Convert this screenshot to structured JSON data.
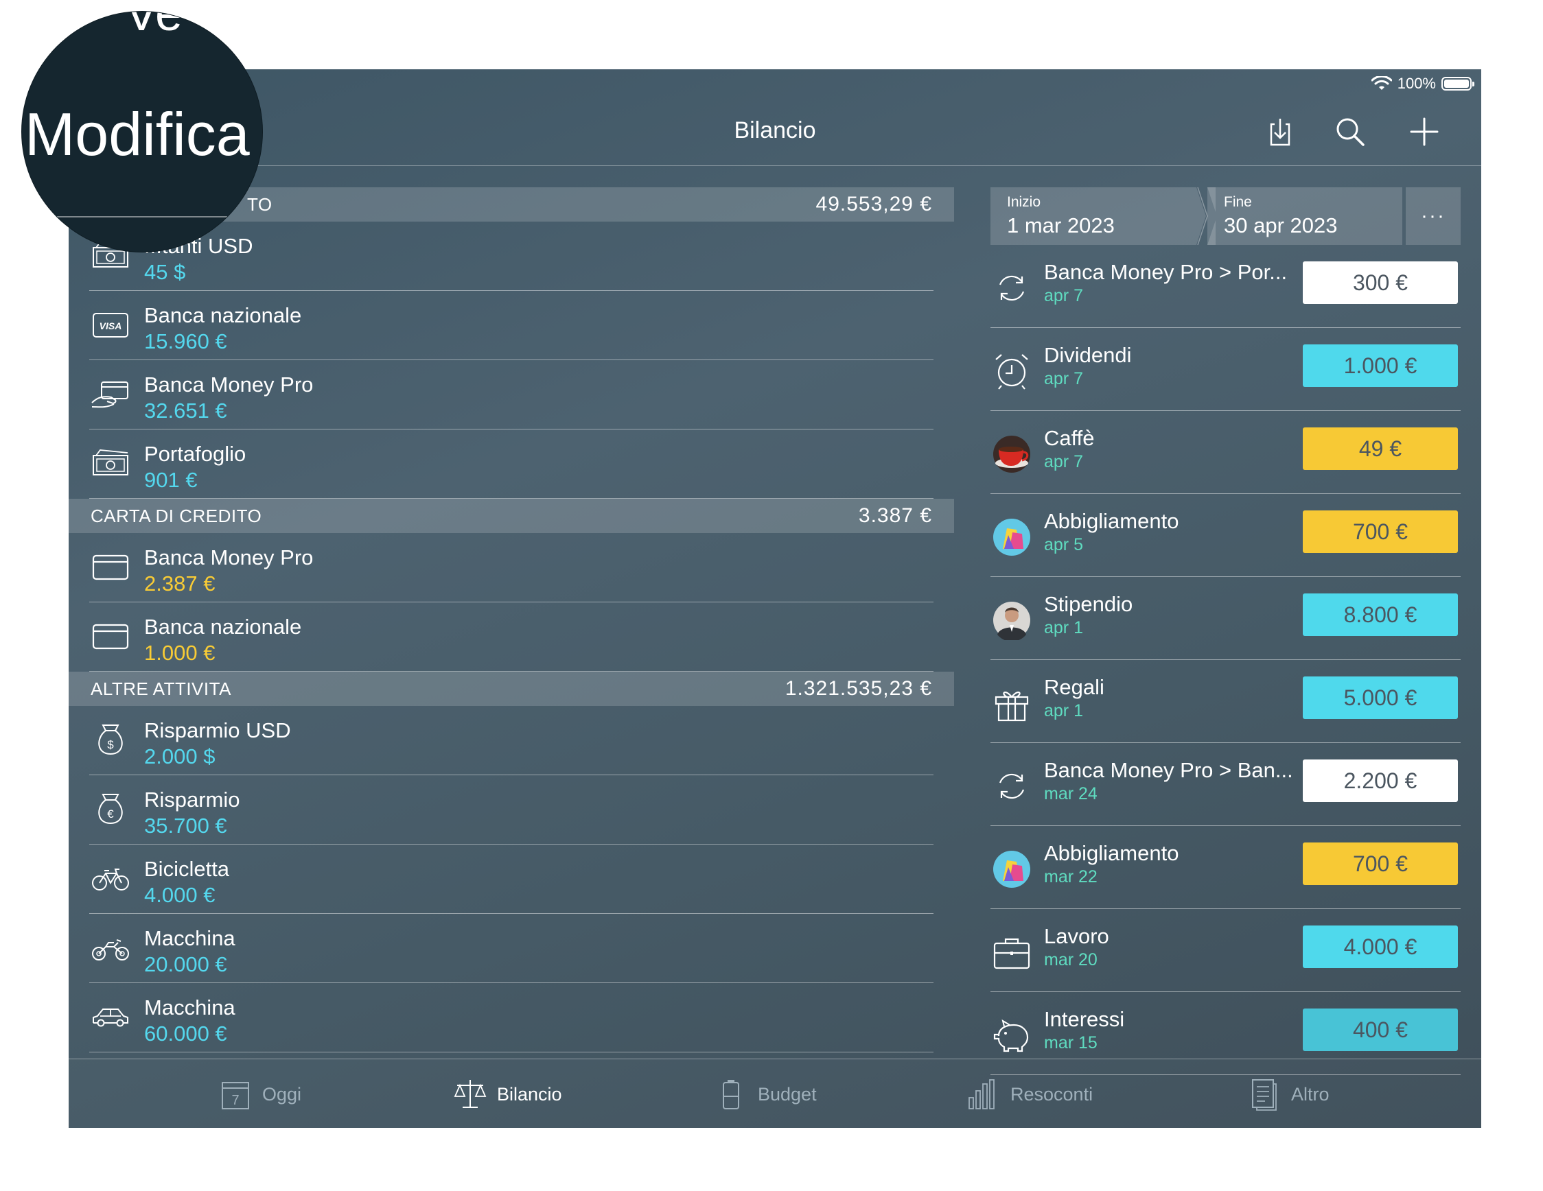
{
  "status": {
    "battery": "100%"
  },
  "navbar": {
    "title": "Bilancio",
    "edit_label": "Modifica",
    "edit_top_fragment": "Ve"
  },
  "sections": [
    {
      "title": "CONTANTI",
      "title_visible": "TO",
      "total": "49.553,29 €",
      "accounts": [
        {
          "name": "Contanti USD",
          "name_visible": "...tanti USD",
          "amount": "45 $",
          "color": "cyan",
          "icon": "cash-icon"
        },
        {
          "name": "Banca nazionale",
          "amount": "15.960 €",
          "color": "cyan",
          "icon": "visa-card-icon"
        },
        {
          "name": "Banca Money Pro",
          "amount": "32.651 €",
          "color": "cyan",
          "icon": "card-in-hand-icon"
        },
        {
          "name": "Portafoglio",
          "amount": "901 €",
          "color": "cyan",
          "icon": "cash-icon"
        }
      ]
    },
    {
      "title": "CARTA DI CREDITO",
      "total": "3.387 €",
      "accounts": [
        {
          "name": "Banca Money Pro",
          "amount": "2.387 €",
          "color": "yellow",
          "icon": "credit-card-icon"
        },
        {
          "name": "Banca nazionale",
          "amount": "1.000 €",
          "color": "yellow",
          "icon": "credit-card-icon"
        }
      ]
    },
    {
      "title": "ALTRE ATTIVITA",
      "total": "1.321.535,23 €",
      "accounts": [
        {
          "name": "Risparmio USD",
          "amount": "2.000 $",
          "color": "cyan",
          "icon": "money-bag-dollar-icon"
        },
        {
          "name": "Risparmio",
          "amount": "35.700 €",
          "color": "cyan",
          "icon": "money-bag-euro-icon"
        },
        {
          "name": "Bicicletta",
          "amount": "4.000 €",
          "color": "cyan",
          "icon": "bicycle-icon"
        },
        {
          "name": "Macchina",
          "amount": "20.000 €",
          "color": "cyan",
          "icon": "motorcycle-icon"
        },
        {
          "name": "Macchina",
          "amount": "60.000 €",
          "color": "cyan",
          "icon": "car-icon"
        }
      ]
    }
  ],
  "date_range": {
    "start_label": "Inizio",
    "start_value": "1 mar 2023",
    "end_label": "Fine",
    "end_value": "30 apr 2023",
    "more": "···"
  },
  "transactions": [
    {
      "name": "Banca Money Pro > Por...",
      "date": "apr 7",
      "amount": "300 €",
      "style": "white",
      "icon": "transfer-icon"
    },
    {
      "name": "Dividendi",
      "date": "apr 7",
      "amount": "1.000 €",
      "style": "cyan",
      "icon": "alarm-clock-icon"
    },
    {
      "name": "Caffè",
      "date": "apr 7",
      "amount": "49 €",
      "style": "yellow",
      "icon": "coffee-cup-icon"
    },
    {
      "name": "Abbigliamento",
      "date": "apr 5",
      "amount": "700 €",
      "style": "yellow",
      "icon": "shopping-bags-icon"
    },
    {
      "name": "Stipendio",
      "date": "apr 1",
      "amount": "8.800 €",
      "style": "cyan",
      "icon": "person-avatar-icon"
    },
    {
      "name": "Regali",
      "date": "apr 1",
      "amount": "5.000 €",
      "style": "cyan",
      "icon": "gift-icon"
    },
    {
      "name": "Banca Money Pro > Ban...",
      "date": "mar 24",
      "amount": "2.200 €",
      "style": "white",
      "icon": "transfer-icon"
    },
    {
      "name": "Abbigliamento",
      "date": "mar 22",
      "amount": "700 €",
      "style": "yellow",
      "icon": "shopping-bags-icon"
    },
    {
      "name": "Lavoro",
      "date": "mar 20",
      "amount": "4.000 €",
      "style": "cyan",
      "icon": "briefcase-icon"
    },
    {
      "name": "Interessi",
      "date": "mar 15",
      "amount": "400 €",
      "style": "cyan-dim",
      "icon": "piggy-bank-icon"
    }
  ],
  "tabs": [
    {
      "label": "Oggi",
      "icon": "calendar-icon",
      "active": false,
      "day": "7"
    },
    {
      "label": "Bilancio",
      "icon": "scales-icon",
      "active": true
    },
    {
      "label": "Budget",
      "icon": "battery-budget-icon",
      "active": false
    },
    {
      "label": "Resoconti",
      "icon": "bar-chart-icon",
      "active": false
    },
    {
      "label": "Altro",
      "icon": "document-icon",
      "active": false
    }
  ],
  "colors": {
    "cyan": "#54d8ee",
    "yellow": "#f9cc35",
    "pill_cyan": "#4fd9ec",
    "pill_yellow": "#f7c935",
    "pill_white": "#ffffff",
    "pill_cyan_dim": "#48c3d6"
  }
}
